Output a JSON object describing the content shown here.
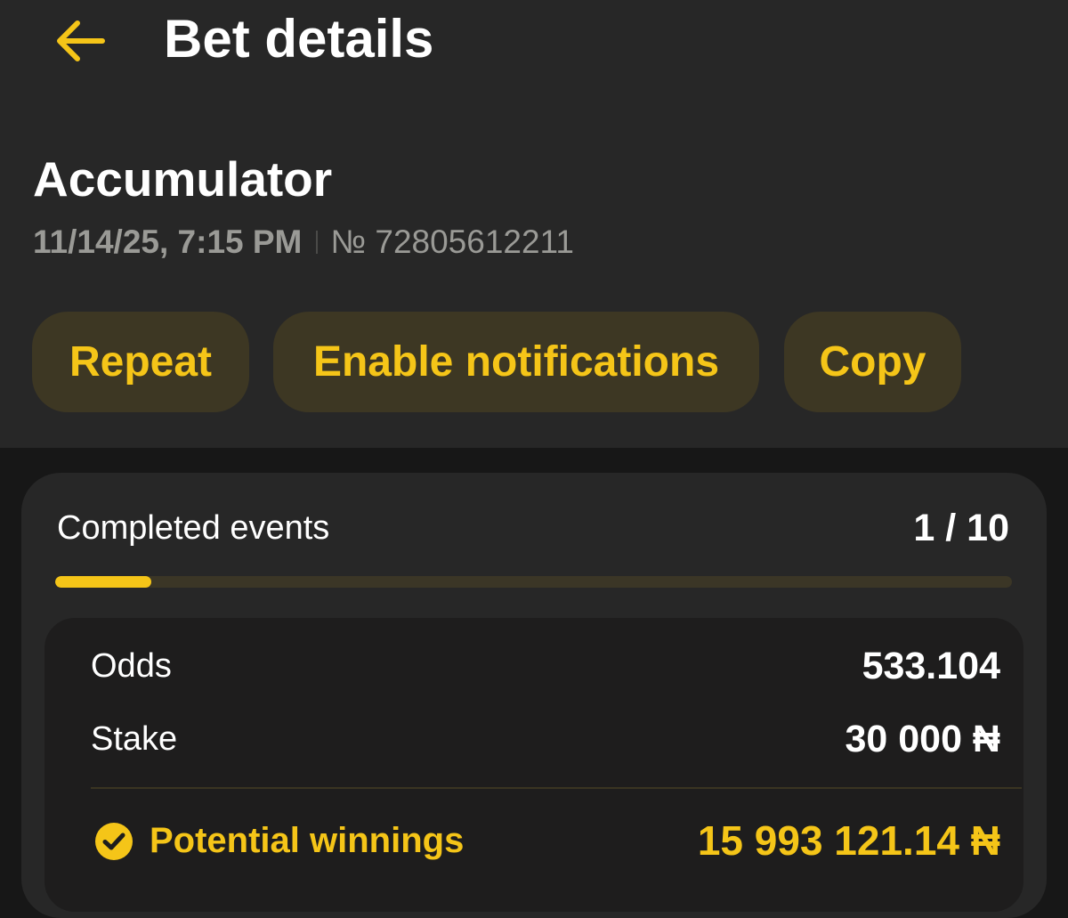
{
  "header": {
    "title": "Bet details",
    "back_icon": "arrow-left-icon"
  },
  "bet": {
    "type": "Accumulator",
    "datetime": "11/14/25, 7:15 PM",
    "number": "№ 72805612211"
  },
  "actions": {
    "repeat_label": "Repeat",
    "notifications_label": "Enable notifications",
    "copy_label": "Copy"
  },
  "progress": {
    "label": "Completed events",
    "count_text": "1 / 10",
    "completed": 1,
    "total": 10
  },
  "summary": {
    "odds_label": "Odds",
    "odds_value": "533.104",
    "stake_label": "Stake",
    "stake_value": "30 000 ₦",
    "winnings_label": "Potential winnings",
    "winnings_value": "15 993 121.14 ₦",
    "winnings_icon": "check-circle-icon"
  },
  "colors": {
    "accent": "#f5c518",
    "header_background": "#272727",
    "page_background": "#171717",
    "button_background": "#3d3723",
    "inner_card_background": "#1e1d1d"
  }
}
